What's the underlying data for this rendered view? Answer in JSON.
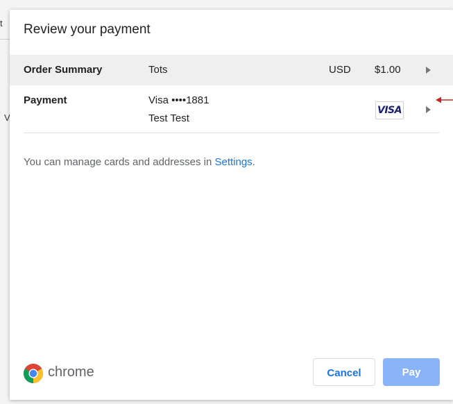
{
  "background": {
    "fragment_top": "t",
    "fragment_mid": "V"
  },
  "dialog": {
    "title": "Review your payment",
    "order_summary": {
      "label": "Order Summary",
      "item": "Tots",
      "currency": "USD",
      "amount": "$1.00"
    },
    "payment": {
      "label": "Payment",
      "card": "Visa ••••1881",
      "name": "Test Test",
      "card_brand_badge": "VISA"
    },
    "manage_text": "You can manage cards and addresses in ",
    "settings_link": "Settings",
    "manage_suffix": ".",
    "brand_text": "chrome",
    "buttons": {
      "cancel": "Cancel",
      "pay": "Pay"
    }
  },
  "colors": {
    "accent": "#1a73e8",
    "pay_button": "#8ab4f8",
    "summary_row": "#efefef",
    "annotation_arrow": "#c62828",
    "visa_blue": "#1a1f71"
  },
  "icons": [
    "chrome-logo-icon",
    "chevron-right-icon",
    "visa-card-icon",
    "annotation-arrow-icon"
  ]
}
